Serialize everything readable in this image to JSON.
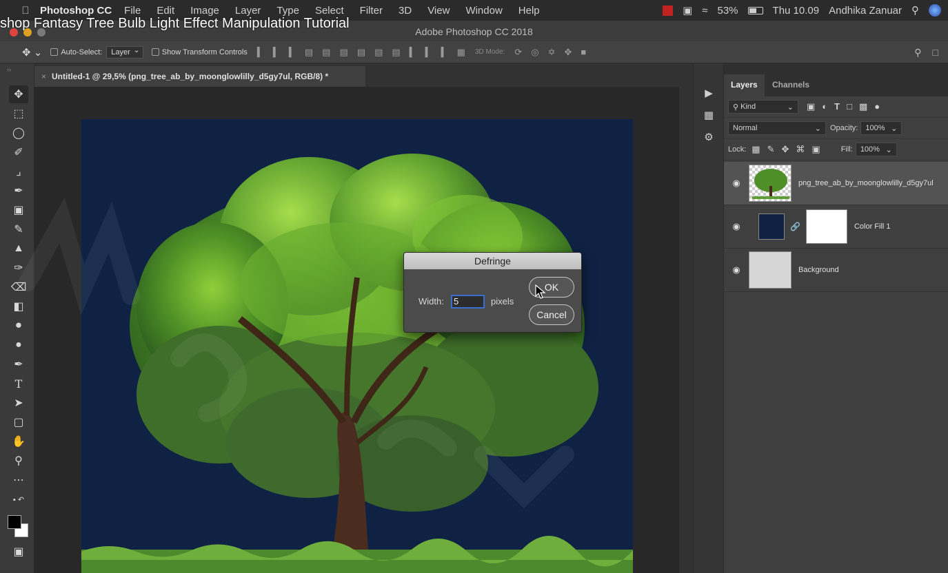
{
  "video": {
    "title": "shop Fantasy Tree Bulb Light Effect Manipulation Tutorial"
  },
  "menubar": {
    "app_name": "Photoshop CC",
    "items": [
      "File",
      "Edit",
      "Image",
      "Layer",
      "Type",
      "Select",
      "Filter",
      "3D",
      "View",
      "Window",
      "Help"
    ],
    "battery": "53%",
    "clock": "Thu 10.09",
    "user": "Andhika Zanuar"
  },
  "window": {
    "title": "Adobe Photoshop CC 2018"
  },
  "options": {
    "auto_select_label": "Auto-Select:",
    "auto_select_value": "Layer",
    "show_transform_label": "Show Transform Controls",
    "mode_3d_label": "3D Mode:"
  },
  "document": {
    "tab_title": "Untitled-1 @ 29,5% (png_tree_ab_by_moonglowlilly_d5gy7ul, RGB/8) *"
  },
  "layers_panel": {
    "tabs": [
      "Layers",
      "Channels"
    ],
    "filter_label": "Kind",
    "blend_mode": "Normal",
    "opacity_label": "Opacity:",
    "opacity_value": "100%",
    "lock_label": "Lock:",
    "fill_label": "Fill:",
    "fill_value": "100%",
    "layers": [
      {
        "name": "png_tree_ab_by_moonglowlilly_d5gy7ul",
        "selected": true
      },
      {
        "name": "Color Fill 1",
        "selected": false,
        "fill_color": "#0f2244"
      },
      {
        "name": "Background",
        "selected": false
      }
    ]
  },
  "dialog": {
    "title": "Defringe",
    "width_label": "Width:",
    "width_value": "5",
    "unit_label": "pixels",
    "ok_label": "OK",
    "cancel_label": "Cancel"
  },
  "icons": {
    "toolbar": [
      "move-icon",
      "marquee-icon",
      "lasso-icon",
      "quick-select-icon",
      "crop-icon",
      "eyedropper-icon",
      "patch-icon",
      "brush-icon",
      "stamp-icon",
      "history-brush-icon",
      "eraser-icon",
      "gradient-icon",
      "blur-icon",
      "dodge-icon",
      "pen-icon",
      "type-icon",
      "path-select-icon",
      "shape-icon",
      "hand-icon",
      "zoom-icon",
      "more-icon"
    ]
  },
  "colors": {
    "canvas_bg": "#0f2244",
    "foreground": "#000000",
    "background": "#ffffff"
  }
}
